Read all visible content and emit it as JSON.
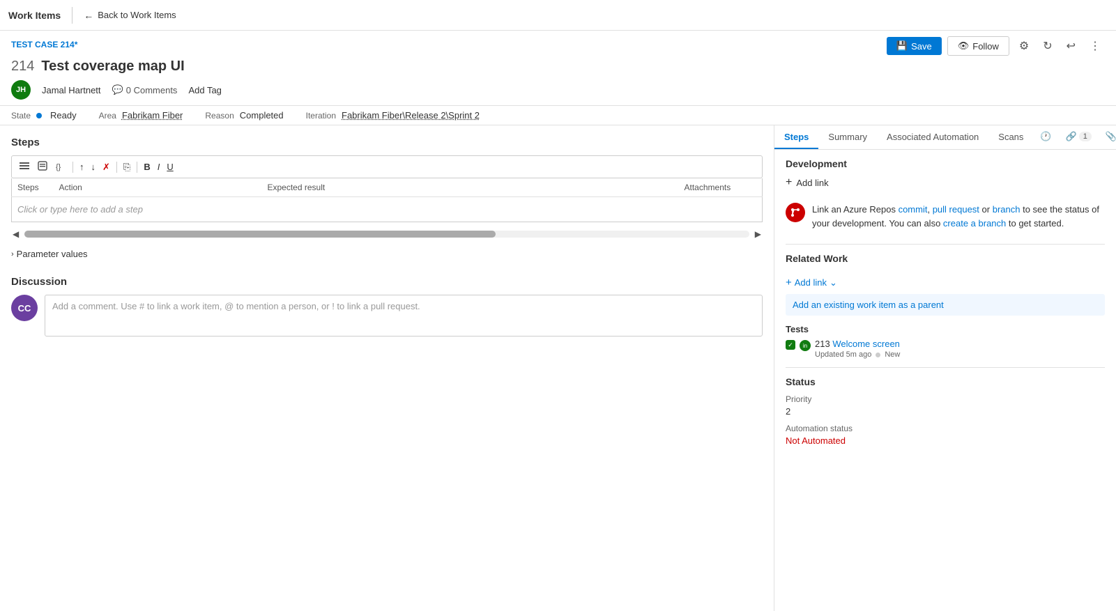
{
  "topbar": {
    "title": "Work Items",
    "back_label": "Back to Work Items"
  },
  "header": {
    "test_case_label": "TEST CASE 214*",
    "work_item_number": "214",
    "work_item_title": "Test coverage map UI",
    "author_initials": "JH",
    "author_name": "Jamal Hartnett",
    "comments_count": "0 Comments",
    "add_tag_label": "Add Tag",
    "save_label": "Save",
    "follow_label": "Follow"
  },
  "fields": {
    "state_label": "State",
    "state_value": "Ready",
    "reason_label": "Reason",
    "reason_value": "Completed",
    "area_label": "Area",
    "area_value": "Fabrikam Fiber",
    "iteration_label": "Iteration",
    "iteration_value": "Fabrikam Fiber\\Release 2\\Sprint 2"
  },
  "tabs": {
    "steps_label": "Steps",
    "summary_label": "Summary",
    "automation_label": "Associated Automation",
    "scans_label": "Scans"
  },
  "steps_section": {
    "title": "Steps",
    "columns": [
      "Steps",
      "Action",
      "Expected result",
      "Attachments"
    ],
    "placeholder": "Click or type here to add a step",
    "param_values_label": "Parameter values"
  },
  "discussion": {
    "title": "Discussion",
    "comment_placeholder": "Add a comment. Use # to link a work item, @ to mention a person, or ! to link a pull request.",
    "commenter_initials": "CC"
  },
  "right_panel": {
    "development": {
      "title": "Development",
      "add_link_label": "Add link",
      "description_start": "Link an Azure Repos ",
      "commit_link": "commit",
      "comma": ", ",
      "pr_link": "pull request",
      "or_text": " or ",
      "branch_link": "branch",
      "description_mid": " to see the status of your development. You can also ",
      "create_link": "create a branch",
      "description_end": " to get started."
    },
    "related_work": {
      "title": "Related Work",
      "add_link_label": "Add link",
      "parent_link_label": "Add an existing work item as a parent"
    },
    "tests": {
      "label": "Tests",
      "item_number": "213",
      "item_title": "Welcome screen",
      "item_meta_time": "Updated 5m ago",
      "item_meta_status": "New"
    },
    "status": {
      "title": "Status",
      "priority_label": "Priority",
      "priority_value": "2",
      "automation_status_label": "Automation status",
      "automation_status_value": "Not Automated"
    }
  }
}
